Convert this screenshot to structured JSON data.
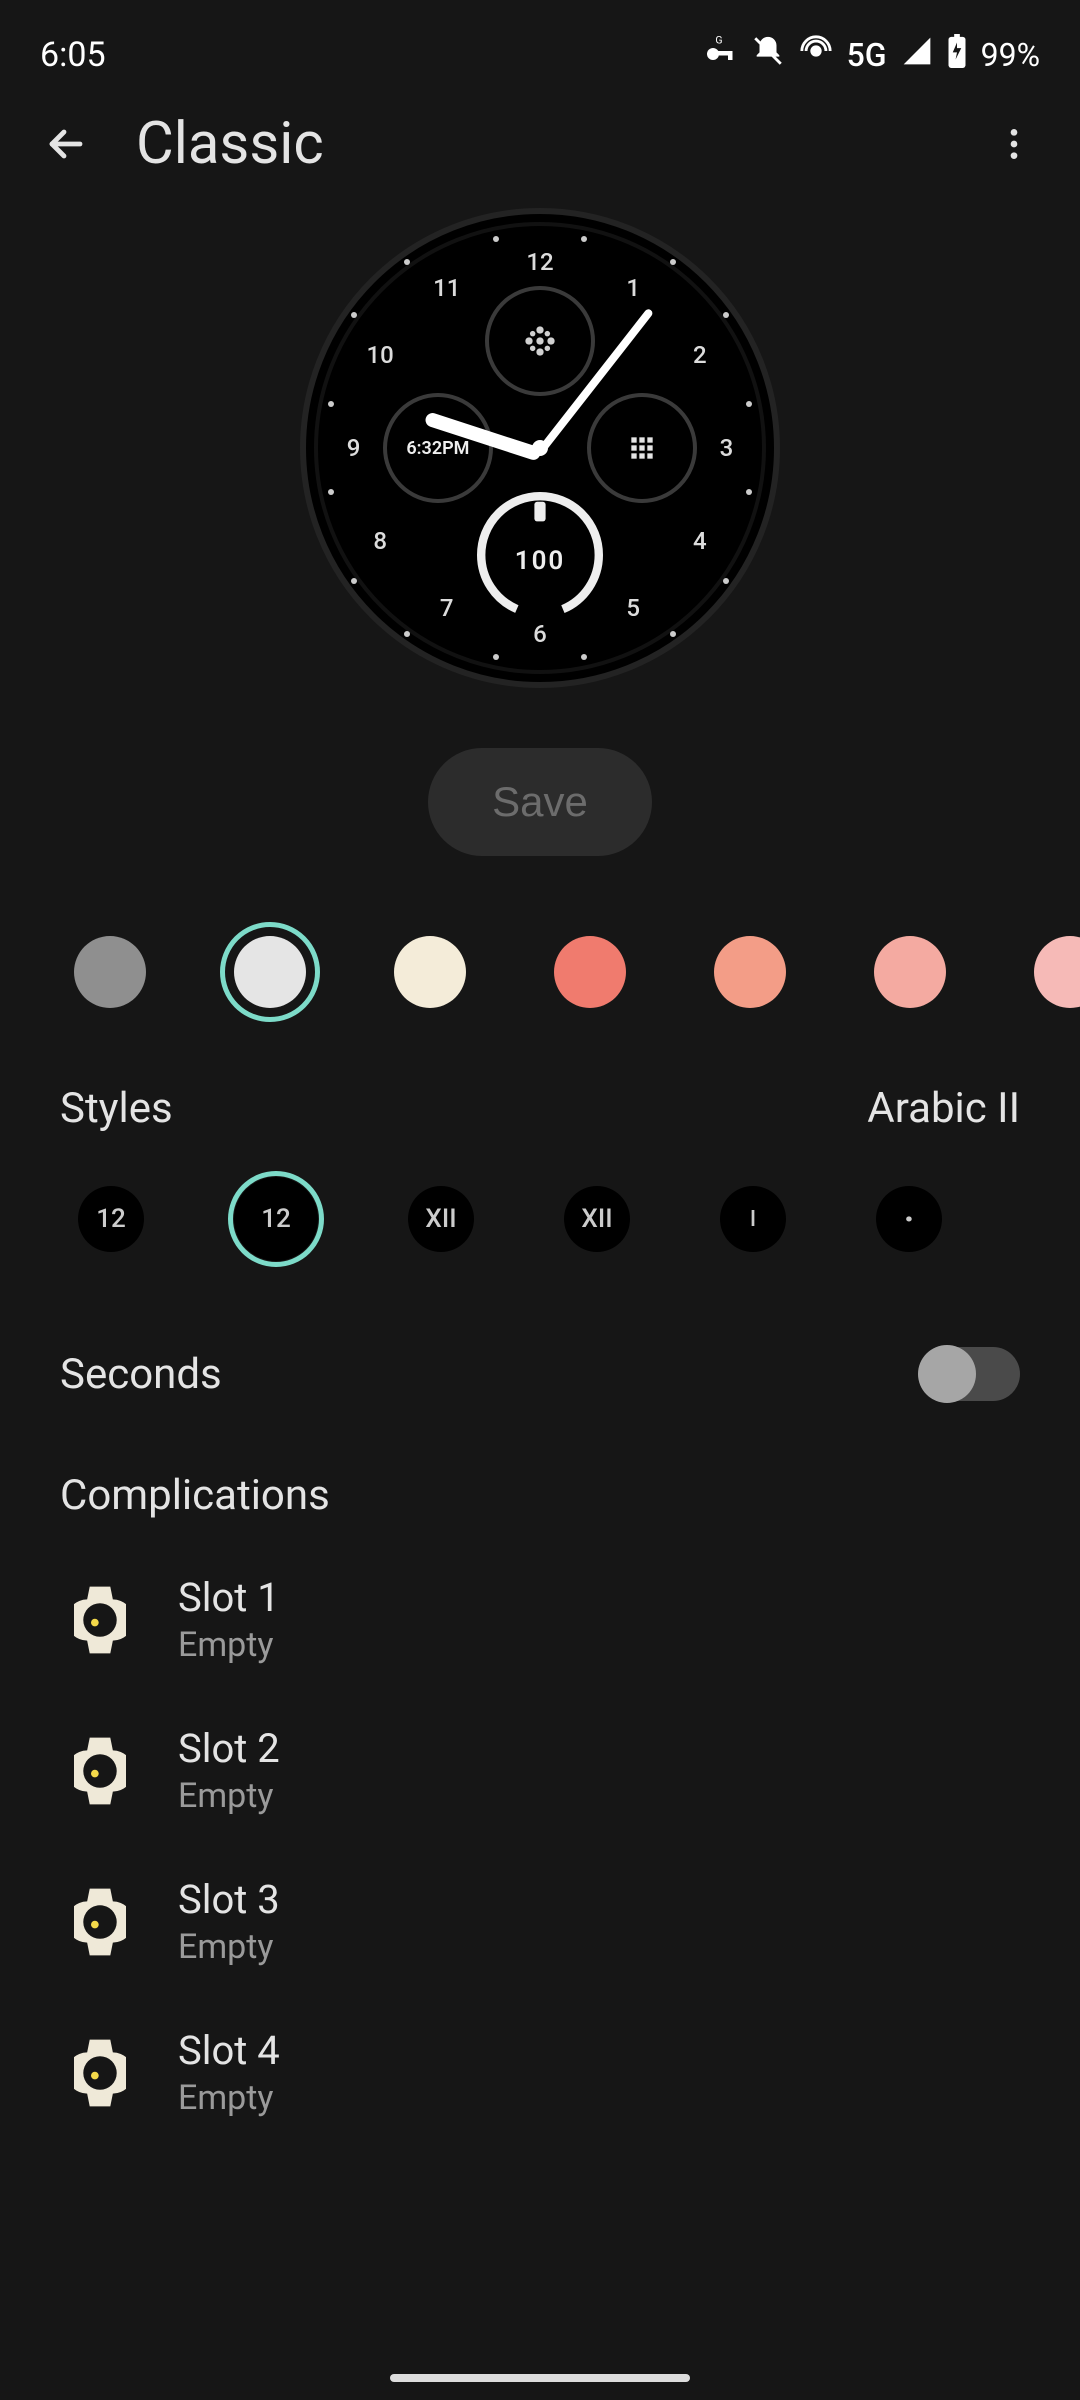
{
  "statusbar": {
    "time": "6:05",
    "network": "5G",
    "battery_percent": "99%"
  },
  "header": {
    "title": "Classic"
  },
  "save_label": "Save",
  "preview": {
    "time_text": "6:32PM",
    "battery_value": "100"
  },
  "colors": [
    {
      "hex": "#8f8f8f",
      "selected": false
    },
    {
      "hex": "#e5e5e5",
      "selected": true
    },
    {
      "hex": "#f4ecd9",
      "selected": false
    },
    {
      "hex": "#f07b6e",
      "selected": false
    },
    {
      "hex": "#f39d87",
      "selected": false
    },
    {
      "hex": "#f4aaa1",
      "selected": false
    },
    {
      "hex": "#f6bab7",
      "selected": false
    }
  ],
  "styles": {
    "section_label": "Styles",
    "selected_name": "Arabic II",
    "options": [
      {
        "label": "12",
        "selected": false
      },
      {
        "label": "12",
        "selected": true
      },
      {
        "label": "XII",
        "selected": false
      },
      {
        "label": "XII",
        "selected": false
      },
      {
        "label": "I",
        "selected": false
      },
      {
        "label": "·",
        "selected": false
      }
    ]
  },
  "seconds": {
    "label": "Seconds",
    "enabled": false
  },
  "complications": {
    "header": "Complications",
    "slots": [
      {
        "title": "Slot 1",
        "value": "Empty"
      },
      {
        "title": "Slot 2",
        "value": "Empty"
      },
      {
        "title": "Slot 3",
        "value": "Empty"
      },
      {
        "title": "Slot 4",
        "value": "Empty"
      }
    ]
  },
  "icons": {
    "back": "arrow-left",
    "more": "more-vert",
    "key": "vpn-key",
    "mute": "notifications-off",
    "hotspot": "hotspot",
    "signal": "cell-signal",
    "battery": "battery-charging"
  }
}
